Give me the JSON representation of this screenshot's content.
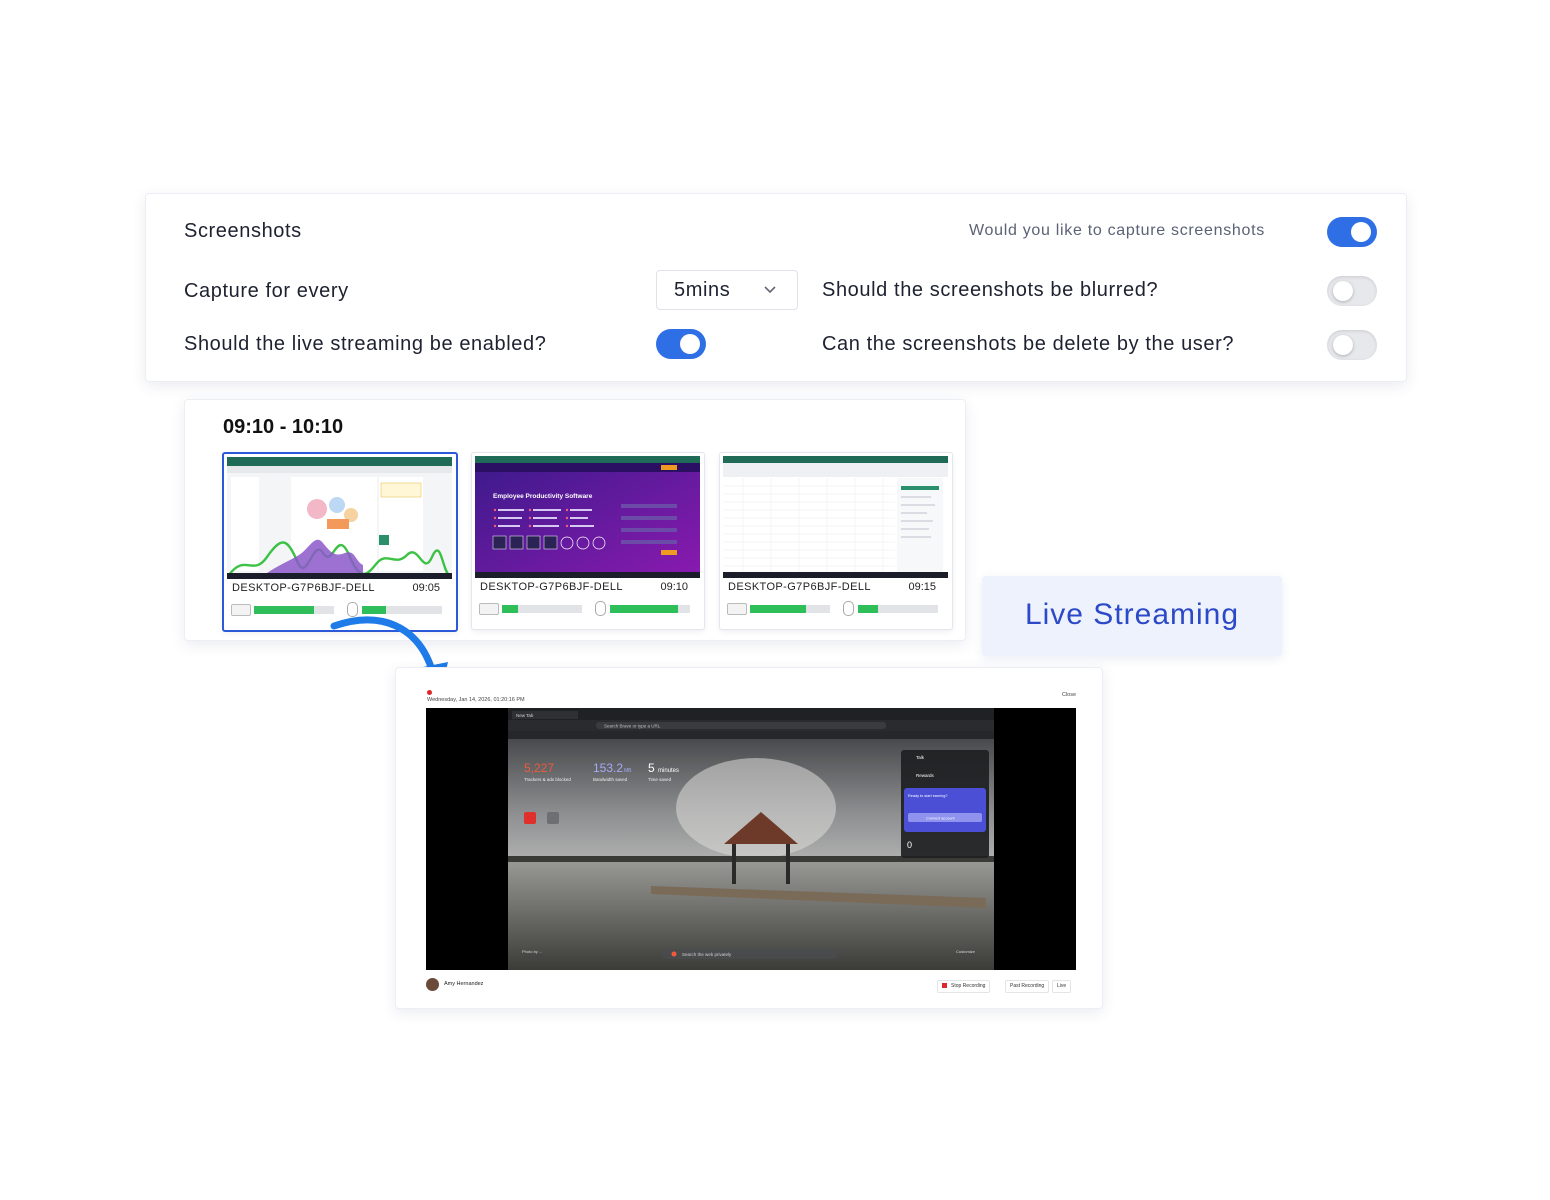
{
  "settings": {
    "title": "Screenshots",
    "capture_question": "Would you like to capture screenshots",
    "capture_enabled": true,
    "interval_label": "Capture for every",
    "interval_value": "5mins",
    "blur_label": "Should the screenshots be blurred?",
    "blur_enabled": false,
    "live_label": "Should the live streaming be enabled?",
    "live_enabled": true,
    "delete_label": "Can the screenshots be delete by the user?",
    "delete_enabled": false,
    "accent_color": "#2f6fe6"
  },
  "strip": {
    "range": "09:10 - 10:10",
    "cards": [
      {
        "host": "DESKTOP-G7P6BJF-DELL",
        "time": "09:05",
        "keyboard_activity": 0.75,
        "mouse_activity": 0.3,
        "selected": true,
        "thumb_title": ""
      },
      {
        "host": "DESKTOP-G7P6BJF-DELL",
        "time": "09:10",
        "keyboard_activity": 0.2,
        "mouse_activity": 0.85,
        "selected": false,
        "thumb_title": "Employee Productivity Software"
      },
      {
        "host": "DESKTOP-G7P6BJF-DELL",
        "time": "09:15",
        "keyboard_activity": 0.7,
        "mouse_activity": 0.25,
        "selected": false,
        "thumb_title": ""
      }
    ]
  },
  "live_badge": "Live Streaming",
  "player": {
    "date": "Wednesday, Jan 14, 2026, 01:20:16 PM",
    "close": "Close",
    "user": "Amy Hernandez",
    "stop_recording": "Stop Recording",
    "past_recording": "Past Recording",
    "live": "Live",
    "browser": {
      "tab": "New Tab",
      "address_placeholder": "Search Brave or type a URL",
      "stat1_value": "5,227",
      "stat1_label": "Trackers & ads blocked",
      "stat2_value": "153.2",
      "stat2_unit": "MB",
      "stat2_label": "Bandwidth saved",
      "stat3_value": "5",
      "stat3_unit": "minutes",
      "stat3_label": "Time saved",
      "panel_title": "Talk",
      "panel_rewards": "Rewards",
      "panel_msg": "Ready to start earning?",
      "panel_btn": "Connect account",
      "panel_count": "0",
      "search_placeholder": "Search the web privately",
      "photo_credit": "Photo by ...",
      "customize": "Customize"
    }
  }
}
